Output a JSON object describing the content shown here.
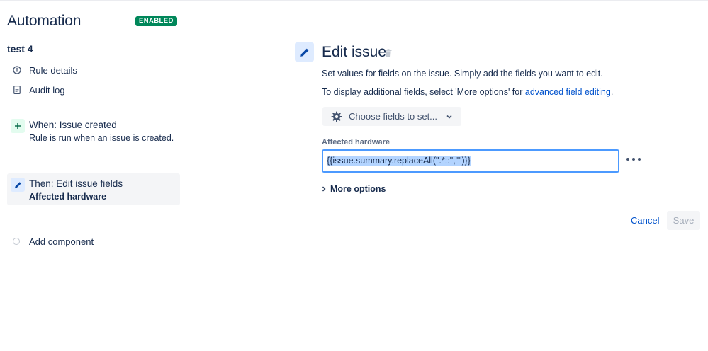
{
  "app": {
    "title": "Automation",
    "status_badge": "ENABLED"
  },
  "rule": {
    "name": "test 4"
  },
  "nav": {
    "items": [
      {
        "label": "Rule details",
        "icon": "info-icon"
      },
      {
        "label": "Audit log",
        "icon": "document-icon"
      }
    ]
  },
  "steps": [
    {
      "title": "When: Issue created",
      "subtitle": "Rule is run when an issue is created.",
      "icon": "plus-icon"
    },
    {
      "title": "Then: Edit issue fields",
      "subtitle": "Affected hardware",
      "icon": "pencil-icon"
    }
  ],
  "add_component": {
    "label": "Add component"
  },
  "panel": {
    "title": "Edit issue",
    "description_1": "Set values for fields on the issue. Simply add the fields you want to edit.",
    "description_2_prefix": "To display additional fields, select 'More options' for ",
    "description_2_link": "advanced field editing",
    "description_2_suffix": ".",
    "choose_fields_label": "Choose fields to set...",
    "field": {
      "label": "Affected hardware",
      "value": "{{issue.summary.replaceAll(\".*::\",\"\")}}"
    },
    "more_options_label": "More options",
    "cancel_label": "Cancel",
    "save_label": "Save"
  },
  "colors": {
    "badge": "#00875a",
    "link": "#0052cc",
    "focus_border": "#4c9aff",
    "selection": "#b3d4ff"
  }
}
